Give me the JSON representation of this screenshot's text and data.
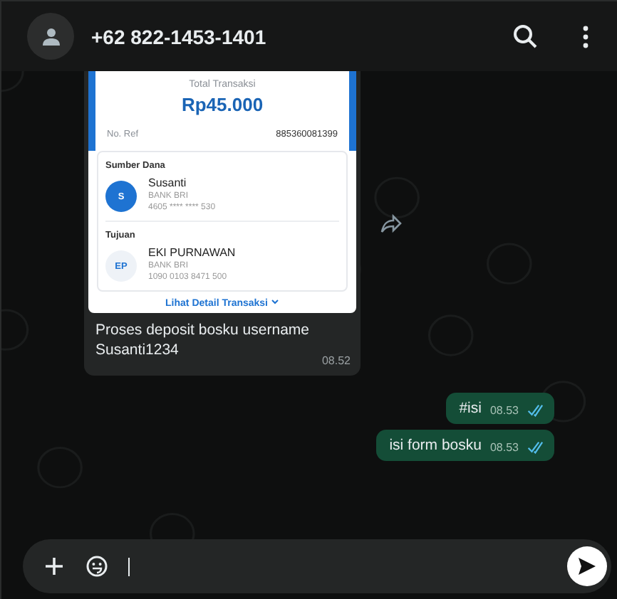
{
  "header": {
    "title": "+62 822-1453-1401"
  },
  "messages": [
    {
      "kind": "image",
      "outgoing": false,
      "forwardable": true,
      "receipt": {
        "total_label": "Total Transaksi",
        "amount": "Rp45.000",
        "ref_label": "No. Ref",
        "ref": "885360081399",
        "parties": [
          {
            "title": "Sumber Dana",
            "initials": "S",
            "filled": true,
            "name": "Susanti",
            "bank": "BANK BRI",
            "account": "4605 **** **** 530"
          },
          {
            "title": "Tujuan",
            "initials": "EP",
            "filled": false,
            "name": "EKI PURNAWAN",
            "bank": "BANK BRI",
            "account": "1090 0103 8471 500"
          }
        ],
        "link": "Lihat Detail Transaksi"
      },
      "caption": "Proses deposit bosku username Susanti1234",
      "time": "08.52"
    },
    {
      "kind": "text",
      "outgoing": true,
      "text": "#isi",
      "time": "08.53",
      "read": true
    },
    {
      "kind": "text",
      "outgoing": true,
      "text": "isi form bosku",
      "time": "08.53",
      "read": true
    }
  ]
}
